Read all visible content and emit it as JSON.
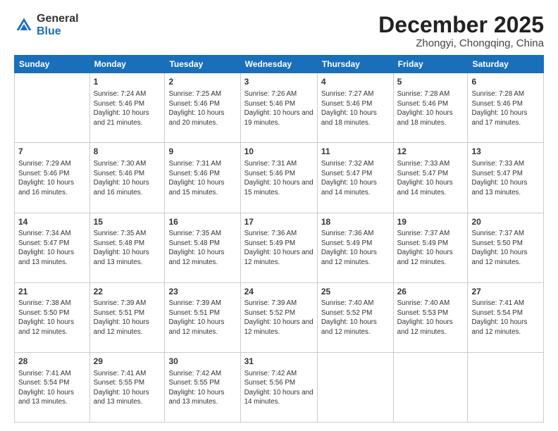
{
  "header": {
    "logo_general": "General",
    "logo_blue": "Blue",
    "month_title": "December 2025",
    "subtitle": "Zhongyi, Chongqing, China"
  },
  "days_of_week": [
    "Sunday",
    "Monday",
    "Tuesday",
    "Wednesday",
    "Thursday",
    "Friday",
    "Saturday"
  ],
  "weeks": [
    [
      {
        "day": "",
        "info": ""
      },
      {
        "day": "1",
        "info": "Sunrise: 7:24 AM\nSunset: 5:46 PM\nDaylight: 10 hours\nand 21 minutes."
      },
      {
        "day": "2",
        "info": "Sunrise: 7:25 AM\nSunset: 5:46 PM\nDaylight: 10 hours\nand 20 minutes."
      },
      {
        "day": "3",
        "info": "Sunrise: 7:26 AM\nSunset: 5:46 PM\nDaylight: 10 hours\nand 19 minutes."
      },
      {
        "day": "4",
        "info": "Sunrise: 7:27 AM\nSunset: 5:46 PM\nDaylight: 10 hours\nand 18 minutes."
      },
      {
        "day": "5",
        "info": "Sunrise: 7:28 AM\nSunset: 5:46 PM\nDaylight: 10 hours\nand 18 minutes."
      },
      {
        "day": "6",
        "info": "Sunrise: 7:28 AM\nSunset: 5:46 PM\nDaylight: 10 hours\nand 17 minutes."
      }
    ],
    [
      {
        "day": "7",
        "info": "Sunrise: 7:29 AM\nSunset: 5:46 PM\nDaylight: 10 hours\nand 16 minutes."
      },
      {
        "day": "8",
        "info": "Sunrise: 7:30 AM\nSunset: 5:46 PM\nDaylight: 10 hours\nand 16 minutes."
      },
      {
        "day": "9",
        "info": "Sunrise: 7:31 AM\nSunset: 5:46 PM\nDaylight: 10 hours\nand 15 minutes."
      },
      {
        "day": "10",
        "info": "Sunrise: 7:31 AM\nSunset: 5:46 PM\nDaylight: 10 hours\nand 15 minutes."
      },
      {
        "day": "11",
        "info": "Sunrise: 7:32 AM\nSunset: 5:47 PM\nDaylight: 10 hours\nand 14 minutes."
      },
      {
        "day": "12",
        "info": "Sunrise: 7:33 AM\nSunset: 5:47 PM\nDaylight: 10 hours\nand 14 minutes."
      },
      {
        "day": "13",
        "info": "Sunrise: 7:33 AM\nSunset: 5:47 PM\nDaylight: 10 hours\nand 13 minutes."
      }
    ],
    [
      {
        "day": "14",
        "info": "Sunrise: 7:34 AM\nSunset: 5:47 PM\nDaylight: 10 hours\nand 13 minutes."
      },
      {
        "day": "15",
        "info": "Sunrise: 7:35 AM\nSunset: 5:48 PM\nDaylight: 10 hours\nand 13 minutes."
      },
      {
        "day": "16",
        "info": "Sunrise: 7:35 AM\nSunset: 5:48 PM\nDaylight: 10 hours\nand 12 minutes."
      },
      {
        "day": "17",
        "info": "Sunrise: 7:36 AM\nSunset: 5:49 PM\nDaylight: 10 hours\nand 12 minutes."
      },
      {
        "day": "18",
        "info": "Sunrise: 7:36 AM\nSunset: 5:49 PM\nDaylight: 10 hours\nand 12 minutes."
      },
      {
        "day": "19",
        "info": "Sunrise: 7:37 AM\nSunset: 5:49 PM\nDaylight: 10 hours\nand 12 minutes."
      },
      {
        "day": "20",
        "info": "Sunrise: 7:37 AM\nSunset: 5:50 PM\nDaylight: 10 hours\nand 12 minutes."
      }
    ],
    [
      {
        "day": "21",
        "info": "Sunrise: 7:38 AM\nSunset: 5:50 PM\nDaylight: 10 hours\nand 12 minutes."
      },
      {
        "day": "22",
        "info": "Sunrise: 7:39 AM\nSunset: 5:51 PM\nDaylight: 10 hours\nand 12 minutes."
      },
      {
        "day": "23",
        "info": "Sunrise: 7:39 AM\nSunset: 5:51 PM\nDaylight: 10 hours\nand 12 minutes."
      },
      {
        "day": "24",
        "info": "Sunrise: 7:39 AM\nSunset: 5:52 PM\nDaylight: 10 hours\nand 12 minutes."
      },
      {
        "day": "25",
        "info": "Sunrise: 7:40 AM\nSunset: 5:52 PM\nDaylight: 10 hours\nand 12 minutes."
      },
      {
        "day": "26",
        "info": "Sunrise: 7:40 AM\nSunset: 5:53 PM\nDaylight: 10 hours\nand 12 minutes."
      },
      {
        "day": "27",
        "info": "Sunrise: 7:41 AM\nSunset: 5:54 PM\nDaylight: 10 hours\nand 12 minutes."
      }
    ],
    [
      {
        "day": "28",
        "info": "Sunrise: 7:41 AM\nSunset: 5:54 PM\nDaylight: 10 hours\nand 13 minutes."
      },
      {
        "day": "29",
        "info": "Sunrise: 7:41 AM\nSunset: 5:55 PM\nDaylight: 10 hours\nand 13 minutes."
      },
      {
        "day": "30",
        "info": "Sunrise: 7:42 AM\nSunset: 5:55 PM\nDaylight: 10 hours\nand 13 minutes."
      },
      {
        "day": "31",
        "info": "Sunrise: 7:42 AM\nSunset: 5:56 PM\nDaylight: 10 hours\nand 14 minutes."
      },
      {
        "day": "",
        "info": ""
      },
      {
        "day": "",
        "info": ""
      },
      {
        "day": "",
        "info": ""
      }
    ]
  ]
}
